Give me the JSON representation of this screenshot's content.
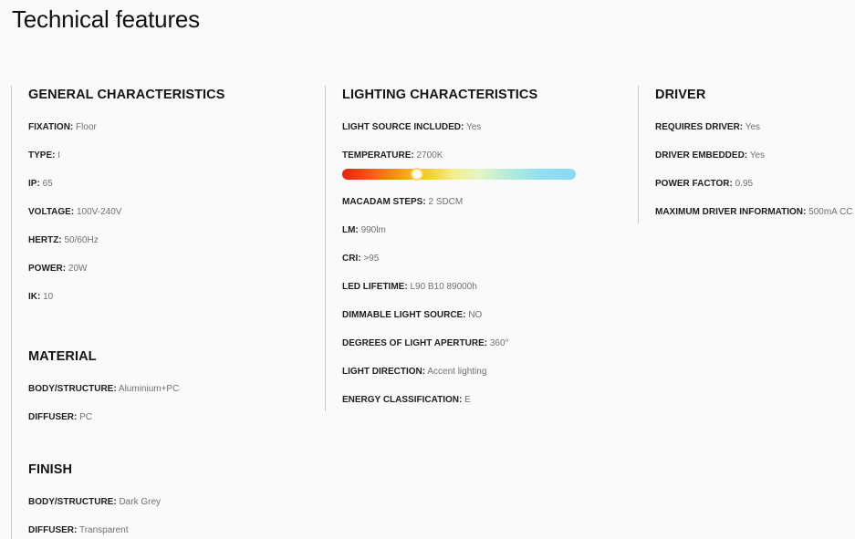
{
  "page": {
    "title": "Technical features"
  },
  "general": {
    "title": "GENERAL CHARACTERISTICS",
    "items": [
      {
        "key": "FIXATION:",
        "value": "Floor"
      },
      {
        "key": "TYPE:",
        "value": "I"
      },
      {
        "key": "IP:",
        "value": "65"
      },
      {
        "key": "VOLTAGE:",
        "value": "100V-240V"
      },
      {
        "key": "HERTZ:",
        "value": "50/60Hz"
      },
      {
        "key": "POWER:",
        "value": "20W"
      },
      {
        "key": "IK:",
        "value": "10"
      }
    ]
  },
  "material": {
    "title": "MATERIAL",
    "items": [
      {
        "key": "BODY/STRUCTURE:",
        "value": "Aluminium+PC"
      },
      {
        "key": "DIFFUSER:",
        "value": "PC"
      }
    ]
  },
  "finish": {
    "title": "FINISH",
    "items": [
      {
        "key": "BODY/STRUCTURE:",
        "value": "Dark Grey"
      },
      {
        "key": "DIFFUSER:",
        "value": "Transparent"
      }
    ]
  },
  "lighting": {
    "title": "LIGHTING CHARACTERISTICS",
    "items": [
      {
        "key": "LIGHT SOURCE INCLUDED:",
        "value": "Yes"
      },
      {
        "key": "TEMPERATURE:",
        "value": "2700K"
      },
      {
        "key": "MACADAM STEPS:",
        "value": "2 SDCM"
      },
      {
        "key": "LM:",
        "value": "990lm"
      },
      {
        "key": "CRI:",
        "value": ">95"
      },
      {
        "key": "LED LIFETIME:",
        "value": "L90 B10 89000h"
      },
      {
        "key": "DIMMABLE LIGHT SOURCE:",
        "value": "NO"
      },
      {
        "key": "DEGREES OF LIGHT APERTURE:",
        "value": "360°"
      },
      {
        "key": "LIGHT DIRECTION:",
        "value": "Accent lighting"
      },
      {
        "key": "ENERGY CLASSIFICATION:",
        "value": "E"
      }
    ],
    "temperature_scale": {
      "marker_fraction": 0.32,
      "colors": {
        "warm": "#e8200f",
        "mid": "#f4ef8c",
        "cool": "#8ad8f3"
      }
    }
  },
  "driver": {
    "title": "DRIVER",
    "items": [
      {
        "key": "REQUIRES DRIVER:",
        "value": "Yes"
      },
      {
        "key": "DRIVER EMBEDDED:",
        "value": "Yes"
      },
      {
        "key": "POWER FACTOR:",
        "value": "0.95"
      },
      {
        "key": "MAXIMUM DRIVER INFORMATION:",
        "value": "500mA CC"
      }
    ]
  }
}
